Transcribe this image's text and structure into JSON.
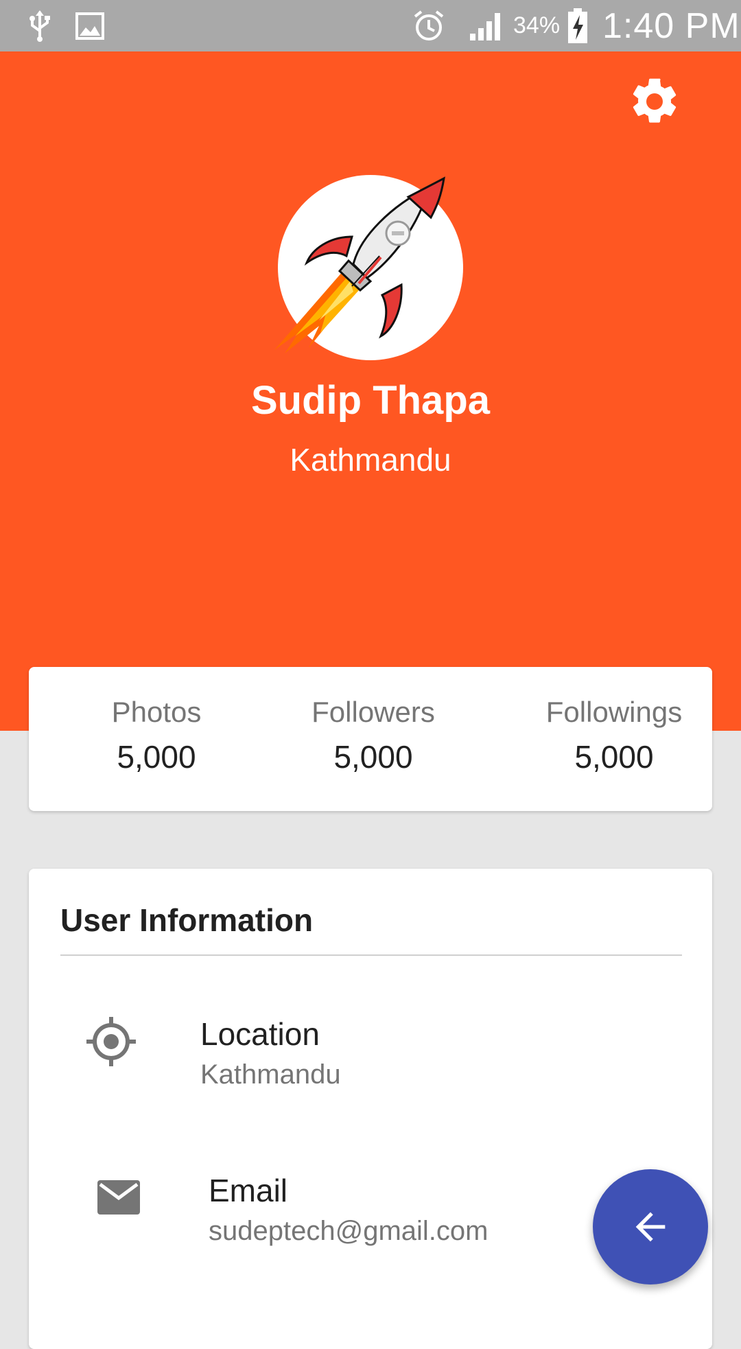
{
  "status_bar": {
    "battery_percent": "34%",
    "time": "1:40 PM",
    "icons": [
      "usb-icon",
      "image-icon",
      "alarm-icon",
      "signal-icon",
      "battery-charging-icon"
    ]
  },
  "header": {
    "background_color": "#ff5722",
    "settings_icon": "gear-icon",
    "avatar_icon": "rocket-icon",
    "name": "Sudip Thapa",
    "city": "Kathmandu"
  },
  "stats": [
    {
      "label": "Photos",
      "value": "5,000"
    },
    {
      "label": "Followers",
      "value": "5,000"
    },
    {
      "label": "Followings",
      "value": "5,000"
    }
  ],
  "user_info": {
    "title": "User Information",
    "rows": [
      {
        "icon": "location-target-icon",
        "label": "Location",
        "value": "Kathmandu"
      },
      {
        "icon": "email-icon",
        "label": "Email",
        "value": "sudeptech@gmail.com"
      }
    ]
  },
  "fab": {
    "icon": "arrow-back-icon",
    "color": "#3f51b5"
  }
}
